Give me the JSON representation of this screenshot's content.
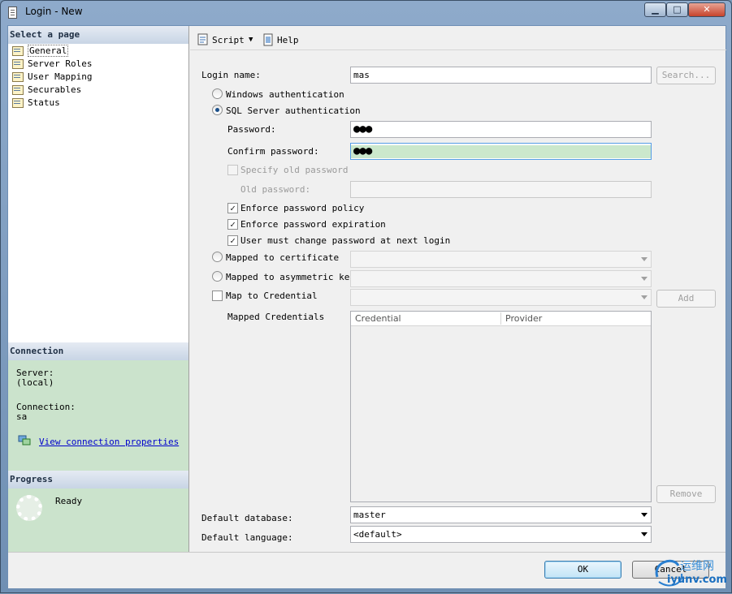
{
  "window": {
    "title": "Login - New"
  },
  "left": {
    "select_page_header": "Select a page",
    "pages": [
      "General",
      "Server Roles",
      "User Mapping",
      "Securables",
      "Status"
    ],
    "connection_header": "Connection",
    "server_label": "Server:",
    "server_value": "(local)",
    "connection_label": "Connection:",
    "connection_value": "sa",
    "view_link": "View connection properties",
    "progress_header": "Progress",
    "progress_status": "Ready"
  },
  "toolbar": {
    "script": "Script",
    "help": "Help"
  },
  "form": {
    "login_name_label": "Login name:",
    "login_name_value": "mas",
    "search_button": "Search...",
    "windows_auth": "Windows authentication",
    "sql_auth": "SQL Server authentication",
    "password_label": "Password:",
    "password_value": "●●●",
    "confirm_label": "Confirm password:",
    "confirm_value": "●●●",
    "specify_old": "Specify old password",
    "old_password_label": "Old password:",
    "enforce_policy": "Enforce password policy",
    "enforce_expiration": "Enforce password expiration",
    "must_change": "User must change password at next login",
    "mapped_cert": "Mapped to certificate",
    "mapped_asym": "Mapped to asymmetric key",
    "map_credential": "Map to Credential",
    "add_button": "Add",
    "mapped_credentials": "Mapped Credentials",
    "grid_col_credential": "Credential",
    "grid_col_provider": "Provider",
    "remove_button": "Remove",
    "default_db_label": "Default database:",
    "default_db_value": "master",
    "default_lang_label": "Default language:",
    "default_lang_value": "<default>"
  },
  "buttons": {
    "ok": "OK",
    "cancel": "Cancel"
  },
  "watermark": {
    "line1": "运维网",
    "line2": "iyunv.com"
  }
}
